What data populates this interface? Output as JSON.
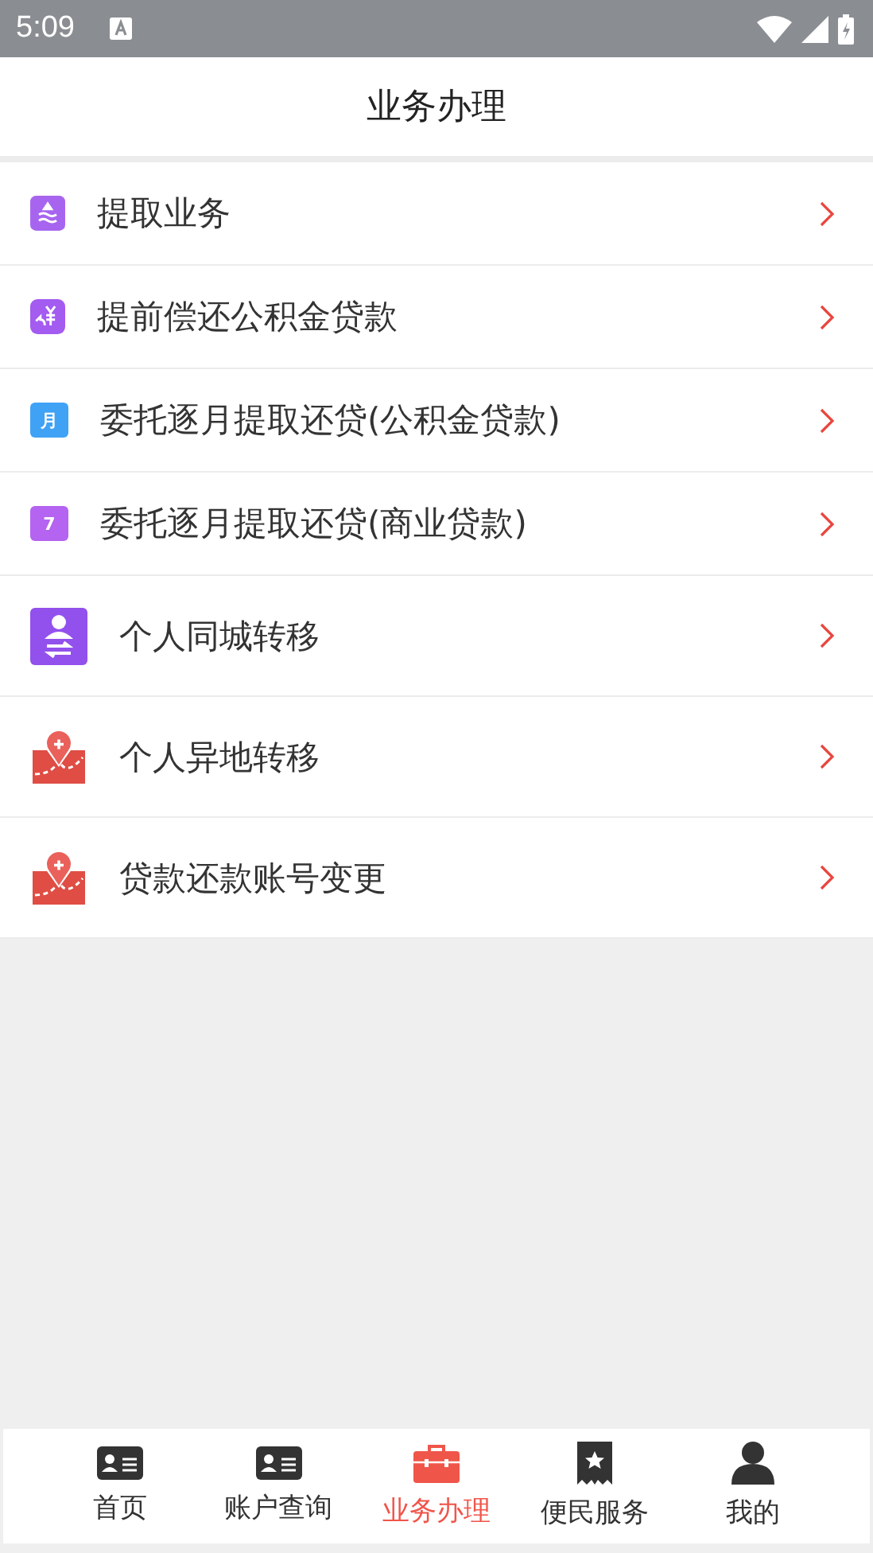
{
  "status_bar": {
    "time": "5:09"
  },
  "header": {
    "title": "业务办理"
  },
  "items": [
    {
      "kind": "drop",
      "label": "提取业务"
    },
    {
      "kind": "yuan",
      "label": "提前偿还公积金贷款"
    },
    {
      "kind": "calendar",
      "icon_text": "月",
      "color": "#3fa2f5",
      "label": "委托逐月提取还贷(公积金贷款)"
    },
    {
      "kind": "calendar",
      "icon_text": "7",
      "color": "#b464f0",
      "label": "委托逐月提取还贷(商业贷款)"
    },
    {
      "kind": "person",
      "label": "个人同城转移"
    },
    {
      "kind": "map",
      "label": "个人异地转移"
    },
    {
      "kind": "map",
      "label": "贷款还款账号变更"
    }
  ],
  "tabs": [
    {
      "kind": "card",
      "label": "首页",
      "selected": false
    },
    {
      "kind": "card",
      "label": "账户查询",
      "selected": false
    },
    {
      "kind": "toolbox",
      "label": "业务办理",
      "selected": true
    },
    {
      "kind": "ribbon",
      "label": "便民服务",
      "selected": false
    },
    {
      "kind": "user",
      "label": "我的",
      "selected": false
    }
  ]
}
